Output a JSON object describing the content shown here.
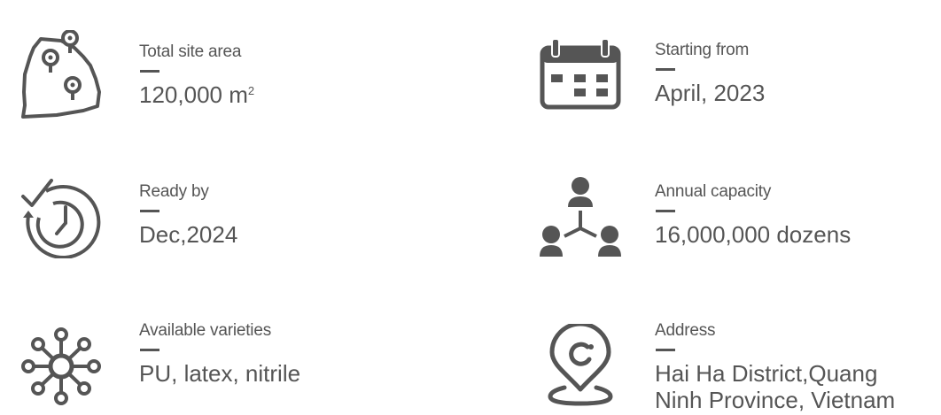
{
  "stats": [
    {
      "icon": "map-pins-icon",
      "label": "Total site area",
      "value": "120,000 m",
      "superscript": "2"
    },
    {
      "icon": "calendar-icon",
      "label": "Starting from",
      "value": "April, 2023"
    },
    {
      "icon": "clock-check-icon",
      "label": "Ready by",
      "value": "Dec,2024"
    },
    {
      "icon": "people-network-icon",
      "label": "Annual capacity",
      "value": "16,000,000 dozens"
    },
    {
      "icon": "molecule-network-icon",
      "label": "Available varieties",
      "value": "PU, latex, nitrile"
    },
    {
      "icon": "location-pin-icon",
      "label": "Address",
      "value_lines": [
        "Hai Ha District,Quang",
        "Ninh Province, Vietnam"
      ]
    }
  ],
  "colors": {
    "text": "#555555",
    "background": "#ffffff"
  }
}
